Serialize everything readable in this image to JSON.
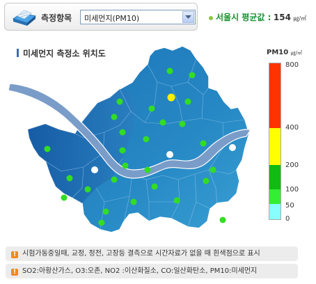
{
  "measure": {
    "label": "측정항목",
    "selected": "미세먼지(PM10)"
  },
  "average": {
    "label": "서울시 평균값 :",
    "value": "154",
    "unit": "㎍/㎥"
  },
  "map": {
    "title": "미세먼지 측정소 위치도"
  },
  "legend": {
    "title": "PM10",
    "unit": "㎍/㎥",
    "ticks": [
      "800",
      "400",
      "200",
      "100",
      "50",
      "0"
    ],
    "colors": {
      "over400": "#ff3300",
      "200to400": "#ffff00",
      "100to200": "#11bb11",
      "50to100": "#33ee33",
      "0to50": "#88ffff"
    }
  },
  "notes": [
    "시험가동중일때, 교정, 정전, 고장등 결측으로 시간자료가 없을 때 흰색점으로 표시",
    "SO2:아황산가스, O3:오존, NO2 :이산화질소, CO:일산화탄소, PM10:미세먼지"
  ],
  "stations": {
    "colors": {
      "normal": "#33dd22",
      "high": "#ffee00",
      "missing": "#ffffff"
    }
  }
}
